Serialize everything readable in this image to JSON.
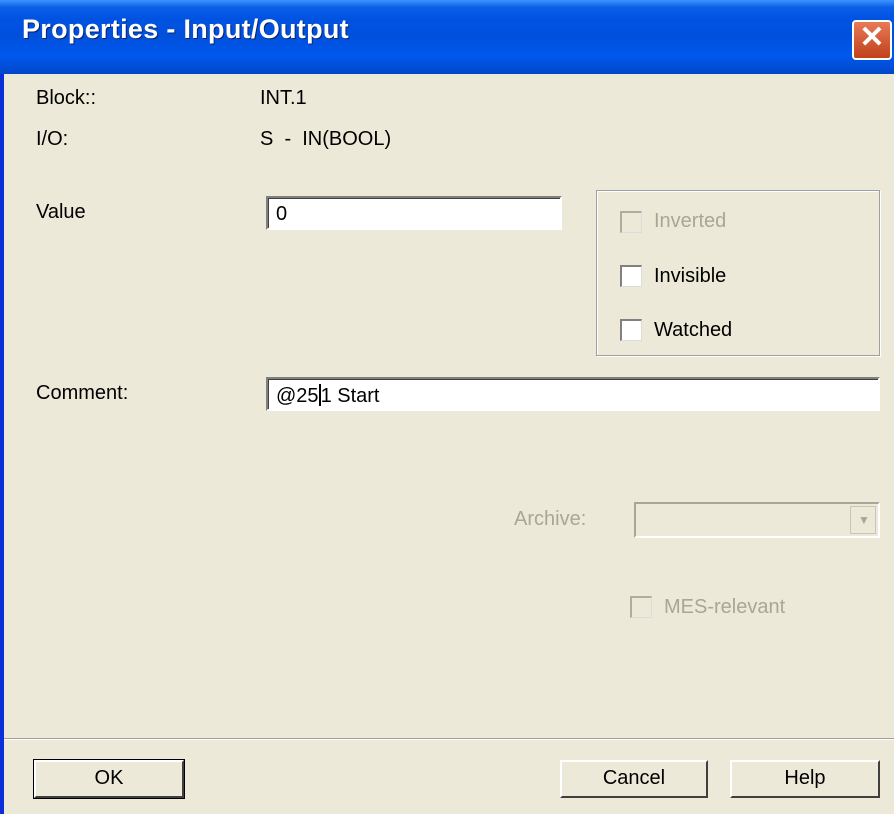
{
  "window": {
    "title": "Properties - Input/Output",
    "close_glyph": "✕"
  },
  "info": {
    "block_label": "Block::",
    "block_value": "INT.1",
    "io_label": "I/O:",
    "io_value": "S  -  IN(BOOL)"
  },
  "value": {
    "label": "Value",
    "field_value": "0"
  },
  "options": {
    "inverted": {
      "label": "Inverted",
      "checked": false,
      "enabled": false
    },
    "invisible": {
      "label": "Invisible",
      "checked": false,
      "enabled": true
    },
    "watched": {
      "label": "Watched",
      "checked": false,
      "enabled": true
    }
  },
  "comment": {
    "label": "Comment:",
    "value_before_cursor": "@25",
    "value_after_cursor": "1 Start"
  },
  "archive": {
    "label": "Archive:",
    "selected": ""
  },
  "mes": {
    "label": "MES-relevant",
    "checked": false
  },
  "buttons": {
    "ok": "OK",
    "cancel": "Cancel",
    "help": "Help"
  },
  "icons": {
    "close": "close-icon",
    "dropdown": "chevron-down-icon"
  }
}
